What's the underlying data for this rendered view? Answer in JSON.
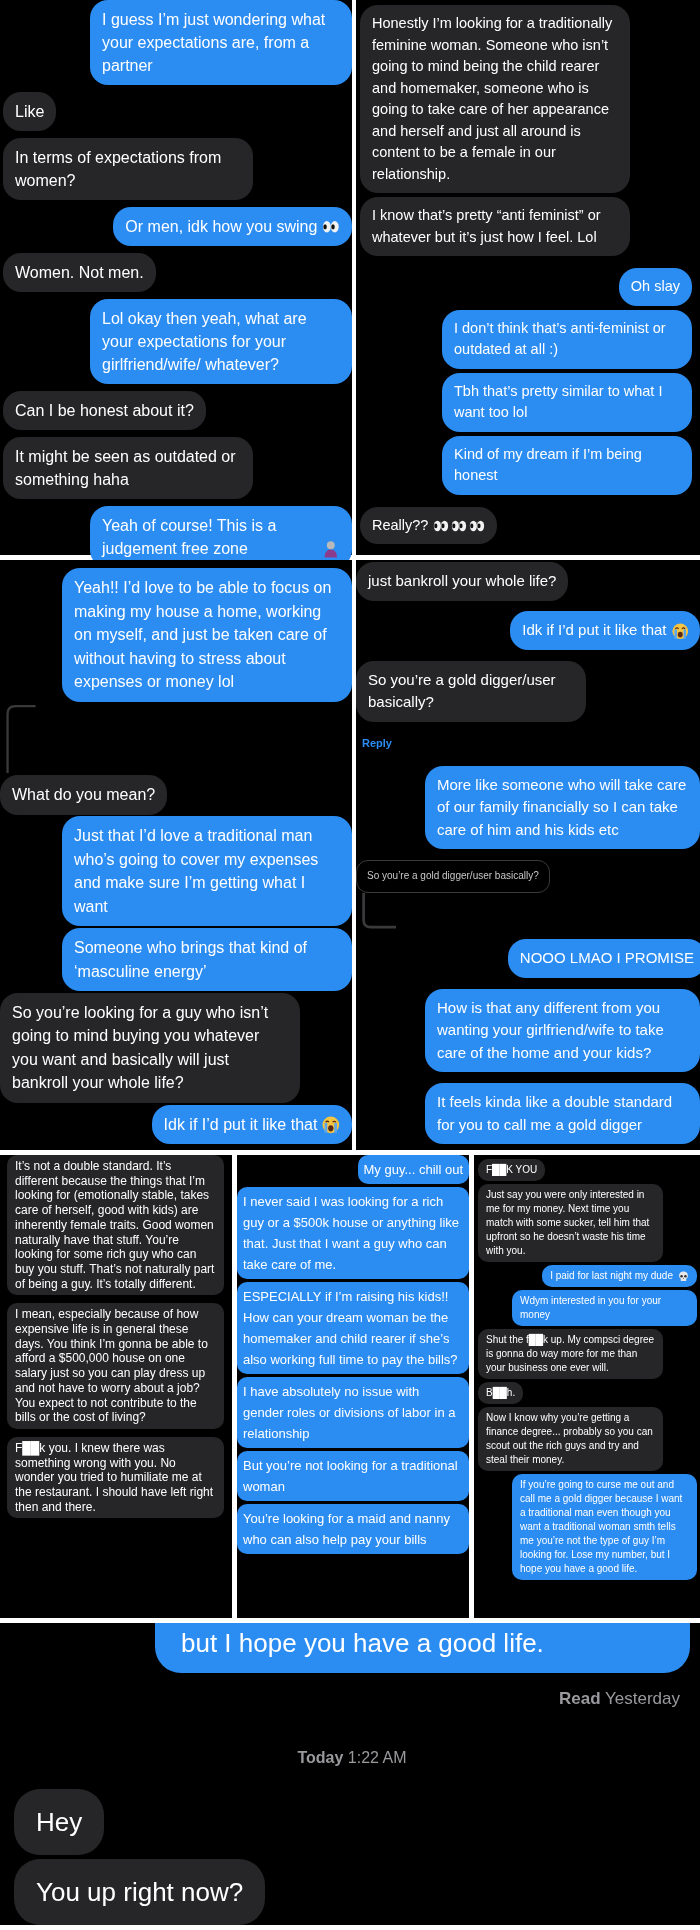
{
  "rows": [
    {
      "panels": [
        {
          "messages": [
            {
              "kind": "sent",
              "text": "I guess I’m just wondering what your expectations are, from a partner"
            },
            {
              "kind": "received",
              "text": "Like"
            },
            {
              "kind": "received",
              "text": "In terms of expectations from women?"
            },
            {
              "kind": "sent",
              "text": "Or men, idk how you swing",
              "emoji": [
                {
                  "kind": "eyes"
                }
              ]
            },
            {
              "kind": "received",
              "text": "Women. Not men."
            },
            {
              "kind": "sent",
              "text": "Lol okay then yeah, what are your expectations for your girlfriend/wife/ whatever?"
            },
            {
              "kind": "received",
              "text": "Can I be honest about it?"
            },
            {
              "kind": "received",
              "text": "It might be seen as outdated or something haha"
            },
            {
              "kind": "sent",
              "text": "Yeah of course! This is a judgement free zone",
              "emoji": [
                {
                  "kind": "figure"
                }
              ]
            }
          ]
        },
        {
          "messages": [
            {
              "kind": "received",
              "text": "Honestly I’m looking for a traditionally feminine woman. Someone who isn’t going to mind being the child rearer and homemaker, someone who is going to take care of her appearance and herself and just all around is content to be a female in our relationship."
            },
            {
              "kind": "received",
              "text": "I know that’s pretty “anti feminist” or whatever but it’s just how I feel. Lol"
            },
            {
              "kind": "sent",
              "text": "Oh slay"
            },
            {
              "kind": "sent",
              "text": "I don’t think that’s anti-feminist or outdated at all :)"
            },
            {
              "kind": "sent",
              "text": "Tbh that’s pretty similar to what I want too lol"
            },
            {
              "kind": "sent",
              "text": "Kind of my dream if I’m being honest"
            },
            {
              "kind": "received",
              "text": "Really??",
              "emoji": [
                {
                  "kind": "eyes"
                },
                {
                  "kind": "eyes"
                },
                {
                  "kind": "eyes"
                }
              ]
            }
          ]
        }
      ]
    },
    {
      "panels": [
        {
          "messages": [
            {
              "kind": "sent",
              "text": "Yeah!! I’d love to be able to focus on making my house a home, working on myself, and just be taken care of without having to stress about expenses or money lol"
            },
            {
              "kind": "connector"
            },
            {
              "kind": "received",
              "text": "What do you mean?"
            },
            {
              "kind": "sent",
              "text": "Just that I’d love a traditional man who’s going to cover my expenses and make sure I’m getting what I want"
            },
            {
              "kind": "sent",
              "text": "Someone who brings that kind of ‘masculine energy’"
            },
            {
              "kind": "received",
              "text": "So you’re looking for a guy who isn’t going to mind buying you whatever you want and basically will just bankroll your whole life?"
            },
            {
              "kind": "sent",
              "text": "Idk if I’d put it like that",
              "emoji": [
                {
                  "kind": "crying"
                }
              ]
            }
          ]
        },
        {
          "messages": [
            {
              "kind": "received",
              "text": "just bankroll your whole life?"
            },
            {
              "kind": "sent",
              "text": "Idk if I’d put it like that",
              "emoji": [
                {
                  "kind": "crying"
                }
              ]
            },
            {
              "kind": "received",
              "text": "So you’re a gold digger/user basically?"
            },
            {
              "kind": "reply_link",
              "text": "Reply"
            },
            {
              "kind": "sent",
              "text": "More like someone who will take care of our family financially so I can take care of him and his kids etc"
            },
            {
              "kind": "reply_quote",
              "text": "So you’re a gold digger/user basically?"
            },
            {
              "kind": "sent",
              "text": "NOOO LMAO I PROMISE"
            },
            {
              "kind": "sent",
              "text": "How is that any different from you wanting your girlfriend/wife to take care of the home and your kids?"
            },
            {
              "kind": "sent",
              "text": "It feels kinda like a double standard for you to call me a gold digger"
            }
          ]
        }
      ]
    },
    {
      "panels": [
        {
          "messages": [
            {
              "kind": "received",
              "text": "It’s not a double standard. It’s different because the things that I’m looking for (emotionally stable, takes care of herself, good with kids) are inherently female traits. Good women naturally have that stuff. You’re looking for some rich guy who can buy you stuff. That’s not naturally part of being a guy. It’s totally different."
            },
            {
              "kind": "received",
              "text": "I mean, especially because of how expensive life is in general these days. You think I’m gonna be able to afford a $500,000 house on one salary just so you can play dress up and not have to worry about a job? You expect to not contribute to the bills or the cost of living?"
            },
            {
              "kind": "received",
              "text": "F██k you. I knew there was something wrong with you. No wonder you tried to humiliate me at the restaurant. I should have left right then and there."
            }
          ]
        },
        {
          "messages": [
            {
              "kind": "sent",
              "text": "My guy... chill out"
            },
            {
              "kind": "sent",
              "text": "I never said I was looking for a rich guy or a $500k house or anything like that. Just that I want a guy who can take care of me."
            },
            {
              "kind": "sent",
              "text": "ESPECIALLY if I’m raising his kids!! How can your dream woman be the homemaker and child rearer if she’s also working full time to pay the bills?"
            },
            {
              "kind": "sent",
              "text": "I have absolutely no issue with gender roles or divisions of labor in a relationship"
            },
            {
              "kind": "sent",
              "text": "But you’re not looking for a traditional woman"
            },
            {
              "kind": "sent",
              "text": "You’re looking for a maid and nanny who can also help pay your bills"
            }
          ]
        },
        {
          "messages": [
            {
              "kind": "received",
              "text": "F██K YOU"
            },
            {
              "kind": "received",
              "text": "Just say you were only interested in me for my money. Next time you match with some sucker, tell him that upfront so he doesn’t waste his time with you."
            },
            {
              "kind": "sent",
              "text": "I paid for last night my dude",
              "emoji": [
                {
                  "kind": "skull"
                }
              ]
            },
            {
              "kind": "sent",
              "text": "Wdym interested in you for your money"
            },
            {
              "kind": "received",
              "text": "Shut the f██k up. My compsci degree is gonna do way more for me than your business one ever will."
            },
            {
              "kind": "received",
              "text": "B██h."
            },
            {
              "kind": "received",
              "text": "Now I know why you’re getting a finance degree... probably so you can scout out the rich guys and try and steal their money."
            },
            {
              "kind": "sent",
              "text": "If you’re going to curse me out and call me a gold digger because I want a traditional man even though you want a traditional woman smth tells me you’re not the type of guy I’m looking for. Lose my number, but I hope you have a good life."
            }
          ]
        }
      ]
    },
    {
      "panels": [
        {
          "messages": [
            {
              "kind": "sent",
              "text": "but I hope you have a good life."
            },
            {
              "kind": "status",
              "text": "**Read** Yesterday"
            },
            {
              "kind": "timestamp",
              "text": "**Today** 1:22 AM"
            },
            {
              "kind": "received",
              "text": "Hey"
            },
            {
              "kind": "received",
              "text": "You up right now?"
            }
          ]
        }
      ]
    }
  ]
}
